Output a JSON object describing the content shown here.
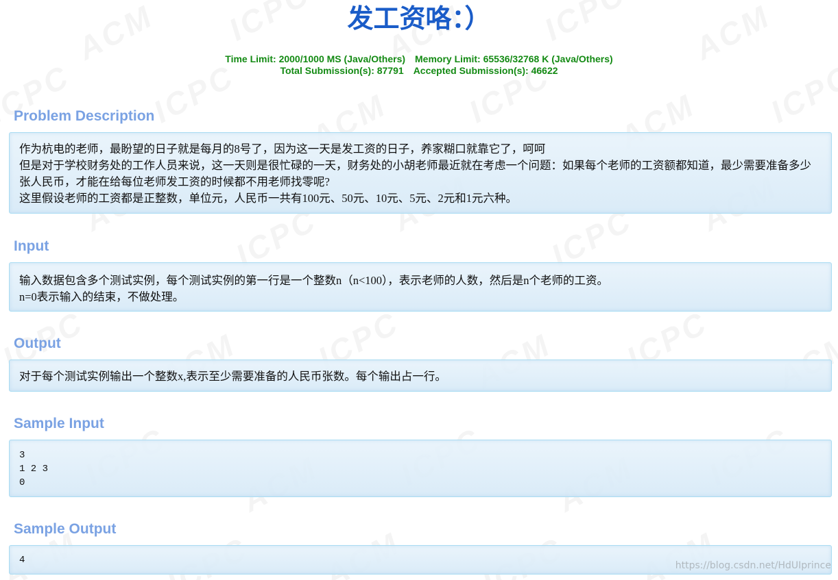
{
  "problem": {
    "title": "发工资咯：）",
    "time_limit": "Time Limit: 2000/1000 MS (Java/Others)",
    "memory_limit": "Memory Limit: 65536/32768 K (Java/Others)",
    "total_submissions": "Total Submission(s): 87791",
    "accepted_submissions": "Accepted Submission(s): 46622"
  },
  "sections": {
    "description": {
      "title": "Problem Description",
      "lines": [
        "作为杭电的老师，最盼望的日子就是每月的8号了，因为这一天是发工资的日子，养家糊口就靠它了，呵呵",
        "但是对于学校财务处的工作人员来说，这一天则是很忙碌的一天，财务处的小胡老师最近就在考虑一个问题：如果每个老师的工资额都知道，最少需要准备多少张人民币，才能在给每位老师发工资的时候都不用老师找零呢?",
        "这里假设老师的工资都是正整数，单位元，人民币一共有100元、50元、10元、5元、2元和1元六种。"
      ]
    },
    "input": {
      "title": "Input",
      "lines": [
        "输入数据包含多个测试实例，每个测试实例的第一行是一个整数n（n<100），表示老师的人数，然后是n个老师的工资。",
        "n=0表示输入的结束，不做处理。"
      ]
    },
    "output": {
      "title": "Output",
      "lines": [
        "对于每个测试实例输出一个整数x,表示至少需要准备的人民币张数。每个输出占一行。"
      ]
    },
    "sample_input": {
      "title": "Sample Input",
      "text": "3\n1 2 3\n0"
    },
    "sample_output": {
      "title": "Sample Output",
      "text": "4"
    }
  },
  "watermark": {
    "text": "https://blog.csdn.net/HdUIprince"
  }
}
